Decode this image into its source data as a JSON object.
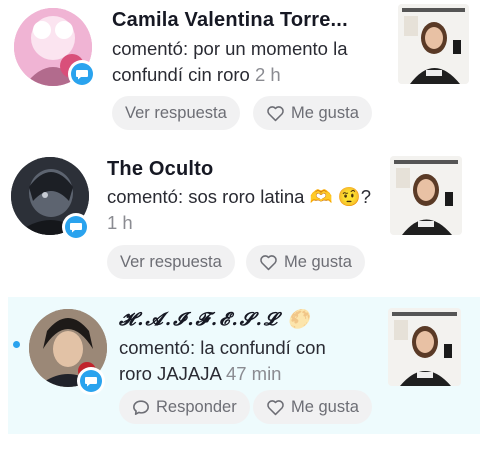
{
  "comments": [
    {
      "username": "Camila Valentina Torre...",
      "prefix": "comentó: ",
      "text": "por un momento la confundí cin roro",
      "time": "2 h",
      "reply_label": "Ver respuesta",
      "like_label": "Me gusta"
    },
    {
      "username": "The Oculto",
      "prefix": "comentó: ",
      "text": "sos roro latina",
      "emojis": "🫶 🤨?",
      "time": "1 h",
      "reply_label": "Ver respuesta",
      "like_label": "Me gusta"
    },
    {
      "username": "𝓗.𝓐.𝓘.𝓕.𝓔.𝓢.𝓛",
      "moon": "🌕",
      "prefix": "comentó: ",
      "text": "la confundí con roro JAJAJA",
      "time": "47 min",
      "reply_label": "Responder",
      "like_label": "Me gusta"
    }
  ],
  "colors": {
    "accent": "#2aa3ee",
    "highlight_bg": "#eefbfd",
    "pill_bg": "#f1f1f2"
  }
}
